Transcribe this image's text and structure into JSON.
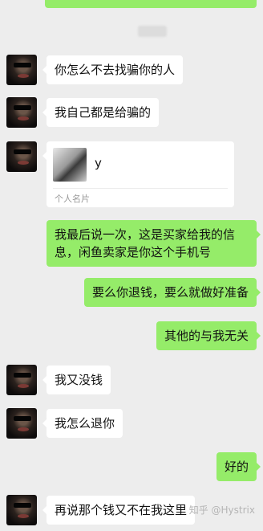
{
  "chat": {
    "messages": [
      {
        "side": "left",
        "text": "你怎么不去找骗你的人"
      },
      {
        "side": "left",
        "text": "我自己都是给骗的"
      },
      {
        "side": "left",
        "type": "card",
        "card_name": "y",
        "card_label": "个人名片"
      },
      {
        "side": "right",
        "text": "我最后说一次，这是买家给我的信息，闲鱼卖家是你这个手机号"
      },
      {
        "side": "right",
        "text": "要么你退钱，要么就做好准备"
      },
      {
        "side": "right",
        "text": "其他的与我无关"
      },
      {
        "side": "left",
        "text": "我又没钱"
      },
      {
        "side": "left",
        "text": "我怎么退你"
      },
      {
        "side": "right",
        "text": "好的"
      },
      {
        "side": "left",
        "text": "再说那个钱又不在我这里"
      }
    ]
  },
  "watermark": "知乎 @Hystrix",
  "colors": {
    "background": "#ededed",
    "incoming": "#ffffff",
    "outgoing": "#95ec69"
  }
}
